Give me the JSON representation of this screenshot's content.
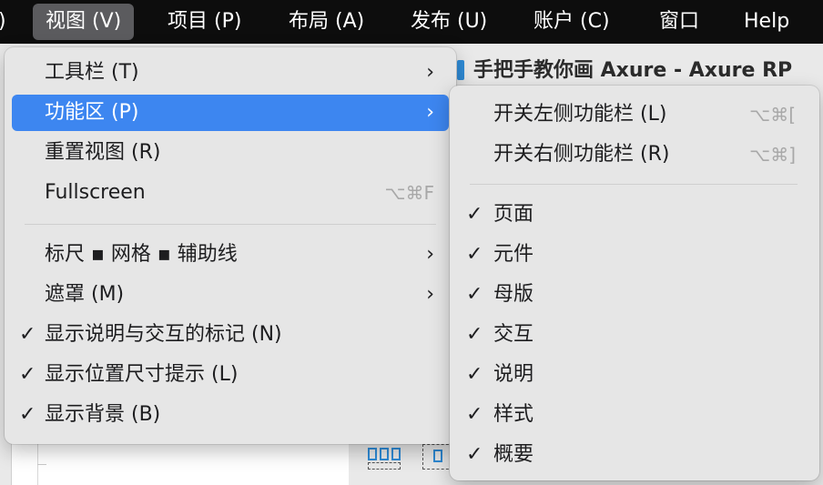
{
  "menubar": {
    "edge": ")",
    "items": [
      "视图 (V)",
      "项目 (P)",
      "布局 (A)",
      "发布 (U)",
      "账户 (C)",
      "窗口",
      "Help"
    ]
  },
  "window": {
    "title": "手把手教你画 Axure - Axure RP"
  },
  "view_menu": {
    "items": [
      {
        "label": "工具栏 (T)",
        "arrow": "›"
      },
      {
        "label": "功能区 (P)",
        "arrow": "›"
      },
      {
        "label": "重置视图 (R)"
      },
      {
        "label": "Fullscreen",
        "shortcut": "⌥⌘F"
      },
      {
        "label": "标尺 ▪ 网格 ▪ 辅助线",
        "arrow": "›"
      },
      {
        "label": "遮罩 (M)",
        "arrow": "›"
      },
      {
        "label": "显示说明与交互的标记 (N)",
        "check": "✓"
      },
      {
        "label": "显示位置尺寸提示 (L)",
        "check": "✓"
      },
      {
        "label": "显示背景 (B)",
        "check": "✓"
      }
    ]
  },
  "ribbon_submenu": {
    "items": [
      {
        "label": "开关左侧功能栏 (L)",
        "shortcut": "⌥⌘["
      },
      {
        "label": "开关右侧功能栏 (R)",
        "shortcut": "⌥⌘]"
      },
      {
        "label": "页面",
        "check": "✓"
      },
      {
        "label": "元件",
        "check": "✓"
      },
      {
        "label": "母版",
        "check": "✓"
      },
      {
        "label": "交互",
        "check": "✓"
      },
      {
        "label": "说明",
        "check": "✓"
      },
      {
        "label": "样式",
        "check": "✓"
      },
      {
        "label": "概要",
        "check": "✓"
      }
    ]
  },
  "colors": {
    "menubar_bg": "#0d0d0d",
    "highlight": "#3d86f0",
    "menu_bg": "#e6e6e6"
  }
}
